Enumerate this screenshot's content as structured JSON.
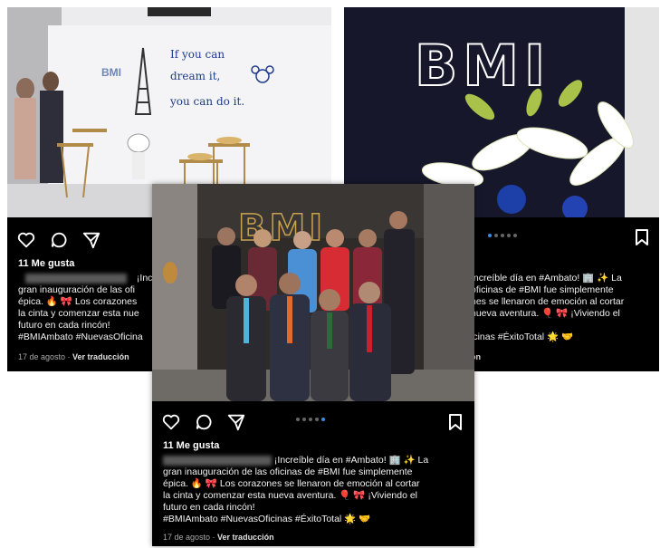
{
  "left_post": {
    "likes": "11 Me gusta",
    "caption_lines": [
      "¡Increíble",
      "gran inauguración de las ofi",
      "épica. 🔥 🎀 Los corazones",
      "la cinta y comenzar esta nue",
      "futuro en cada rincón!",
      "#BMIAmbato #NuevasOficina"
    ],
    "date": "17 de agosto",
    "translate": "Ver traducción",
    "wall_quote": [
      "If you can",
      "dream it,",
      "you can do it."
    ],
    "wall_logo": "BMI"
  },
  "right_post": {
    "brand": "BMI",
    "caption_lines": [
      "Increíble día en #Ambato! 🏢 ✨ La",
      "oficinas de #BMI fue simplemente",
      "nes se llenaron de emoción al cortar",
      "nueva aventura. 🎈 🎀 ¡Viviendo el",
      "",
      "icinas #ÉxitoTotal 🌟 🤝"
    ],
    "meta_fragment": "ón"
  },
  "front_post": {
    "likes": "11 Me gusta",
    "caption_lines": [
      "¡Increíble día en #Ambato! 🏢 ✨ La",
      "gran inauguración de las oficinas de #BMI fue simplemente",
      "épica. 🔥 🎀 Los corazones se llenaron de emoción al cortar",
      "la cinta y comenzar esta nueva aventura. 🎈 🎀 ¡Viviendo el",
      "futuro en cada rincón!",
      "#BMIAmbato #NuevasOficinas #ÉxitoTotal 🌟 🤝"
    ],
    "date": "17 de agosto",
    "translate": "Ver traducción",
    "sign_letters": "BMI"
  },
  "icons": [
    "heart-icon",
    "comment-icon",
    "share-icon",
    "bookmark-icon"
  ],
  "colors": {
    "card_bg": "#000000",
    "carousel_active": "#3a8dde",
    "meta": "#a8a8a8"
  }
}
